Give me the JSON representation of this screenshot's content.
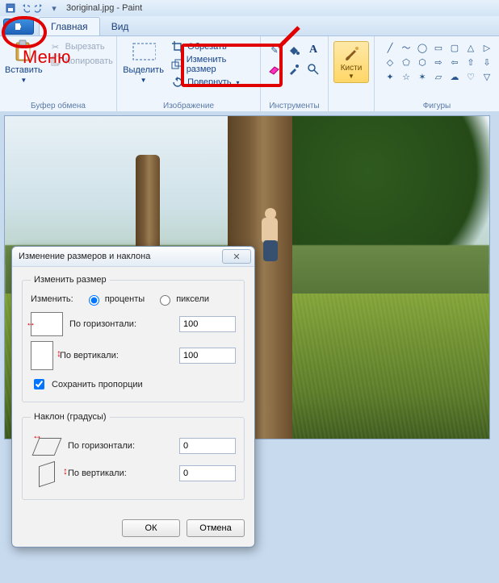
{
  "titlebar": {
    "document": "3original.jpg - Paint"
  },
  "tabs": {
    "home": "Главная",
    "view": "Вид"
  },
  "clipboard": {
    "paste": "Вставить",
    "cut": "Вырезать",
    "copy": "Копировать",
    "group": "Буфер обмена"
  },
  "image": {
    "select": "Выделить",
    "crop": "Обрезать",
    "resize": "Изменить размер",
    "rotate": "Повернуть",
    "group": "Изображение"
  },
  "tools": {
    "group": "Инструменты",
    "brushes": "Кисти"
  },
  "shapes": {
    "group": "Фигуры"
  },
  "annotation": {
    "menu_label": "Меню"
  },
  "dialog": {
    "title": "Изменение размеров и наклона",
    "resize_legend": "Изменить размер",
    "by_label": "Изменить:",
    "percent": "проценты",
    "pixels": "пиксели",
    "horiz": "По горизонтали:",
    "vert": "По вертикали:",
    "h_value": "100",
    "v_value": "100",
    "keep_aspect": "Сохранить пропорции",
    "skew_legend": "Наклон (градусы)",
    "skew_h_value": "0",
    "skew_v_value": "0",
    "ok": "ОК",
    "cancel": "Отмена"
  }
}
